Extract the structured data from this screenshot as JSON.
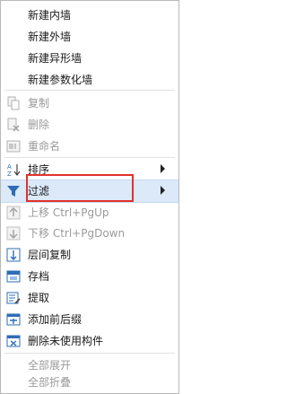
{
  "colors": {
    "highlight": "#dbe9f9",
    "annotation_box": "#e0322b",
    "disabled_text": "#9a9a9a",
    "icon_blue": "#2f6db5"
  },
  "items": [
    {
      "label": "新建内墙",
      "disabled": false,
      "icon": ""
    },
    {
      "label": "新建外墙",
      "disabled": false,
      "icon": ""
    },
    {
      "label": "新建异形墙",
      "disabled": false,
      "icon": ""
    },
    {
      "label": "新建参数化墙",
      "disabled": false,
      "icon": ""
    },
    {
      "label": "复制",
      "disabled": true,
      "icon": "copy-icon"
    },
    {
      "label": "删除",
      "disabled": true,
      "icon": "delete-icon"
    },
    {
      "label": "重命名",
      "disabled": true,
      "icon": "rename-icon"
    },
    {
      "label": "排序",
      "disabled": false,
      "icon": "sort-icon",
      "submenu": true
    },
    {
      "label": "过滤",
      "disabled": false,
      "icon": "filter-icon",
      "submenu": true,
      "highlighted": true
    },
    {
      "label": "上移 Ctrl+PgUp",
      "disabled": true,
      "icon": "move-up-icon"
    },
    {
      "label": "下移 Ctrl+PgDown",
      "disabled": true,
      "icon": "move-down-icon"
    },
    {
      "label": "层间复制",
      "disabled": false,
      "icon": "floor-copy-icon"
    },
    {
      "label": "存档",
      "disabled": false,
      "icon": "archive-icon"
    },
    {
      "label": "提取",
      "disabled": false,
      "icon": "extract-icon"
    },
    {
      "label": "添加前后缀",
      "disabled": false,
      "icon": "add-affix-icon"
    },
    {
      "label": "删除未使用构件",
      "disabled": false,
      "icon": "delete-unused-icon"
    },
    {
      "label": "全部展开",
      "disabled": true,
      "icon": ""
    },
    {
      "label": "全部折叠",
      "disabled": true,
      "icon": ""
    }
  ]
}
